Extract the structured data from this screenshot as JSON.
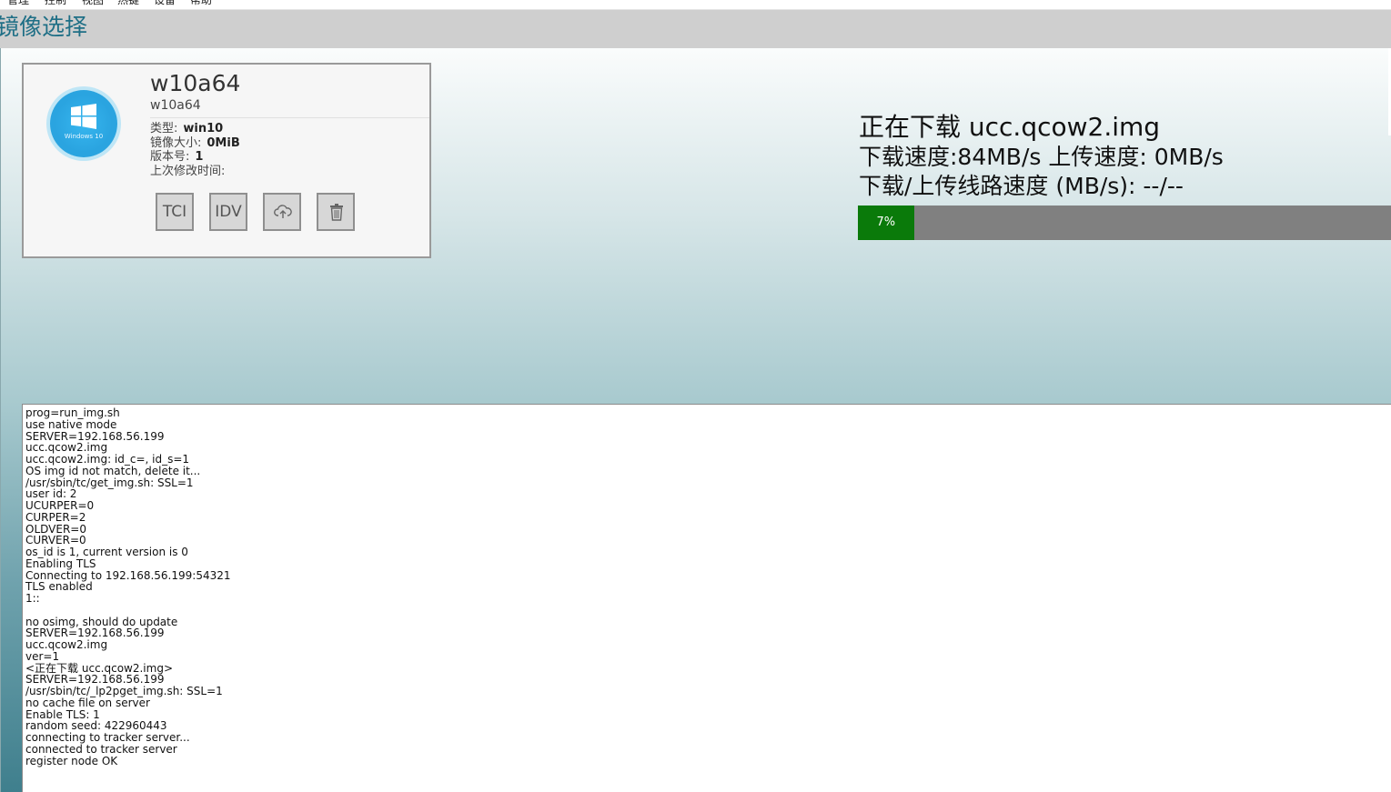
{
  "menubar": {
    "items": [
      "管理",
      "控制",
      "视图",
      "热键",
      "设备",
      "帮助"
    ]
  },
  "header": {
    "title": "镜像选择"
  },
  "image_card": {
    "name": "w10a64",
    "subtitle": "w10a64",
    "logo_text": "Windows 10",
    "type_label": "类型:",
    "type_value": "win10",
    "size_label": "镜像大小:",
    "size_value": "0MiB",
    "version_label": "版本号:",
    "version_value": "1",
    "modified_label": "上次修改时间:",
    "modified_value": "",
    "buttons": {
      "tci": "TCI",
      "idv": "IDV",
      "upload_icon": "cloud-upload-icon",
      "delete_icon": "trash-icon"
    }
  },
  "status": {
    "downloading": "正在下载 ucc.qcow2.img",
    "speed": "下载速度:84MB/s 上传速度: 0MB/s",
    "line_speed": "下载/上传线路速度 (MB/s): --/--",
    "progress_label": "7%",
    "progress_percent": 7
  },
  "colors": {
    "title": "#1f6f86",
    "progress_fill": "#0a7a0a",
    "progress_track": "#808080",
    "logo": "#2aa4e0"
  },
  "log": {
    "lines": [
      "prog=run_img.sh",
      "use native mode",
      "SERVER=192.168.56.199",
      "ucc.qcow2.img",
      "ucc.qcow2.img: id_c=, id_s=1",
      "OS img id not match, delete it...",
      "/usr/sbin/tc/get_img.sh: SSL=1",
      "user id: 2",
      "UCURPER=0",
      "CURPER=2",
      "OLDVER=0",
      "CURVER=0",
      "os_id is 1, current version is 0",
      "Enabling TLS",
      "Connecting to 192.168.56.199:54321",
      "TLS enabled",
      "1::",
      "",
      "no osimg, should do update",
      "SERVER=192.168.56.199",
      "ucc.qcow2.img",
      "ver=1",
      "<正在下载 ucc.qcow2.img>",
      "SERVER=192.168.56.199",
      "/usr/sbin/tc/_lp2pget_img.sh: SSL=1",
      "no cache file on server",
      "Enable TLS: 1",
      "random seed: 422960443",
      "connecting to tracker server...",
      "connected to tracker server",
      "register node OK"
    ]
  }
}
